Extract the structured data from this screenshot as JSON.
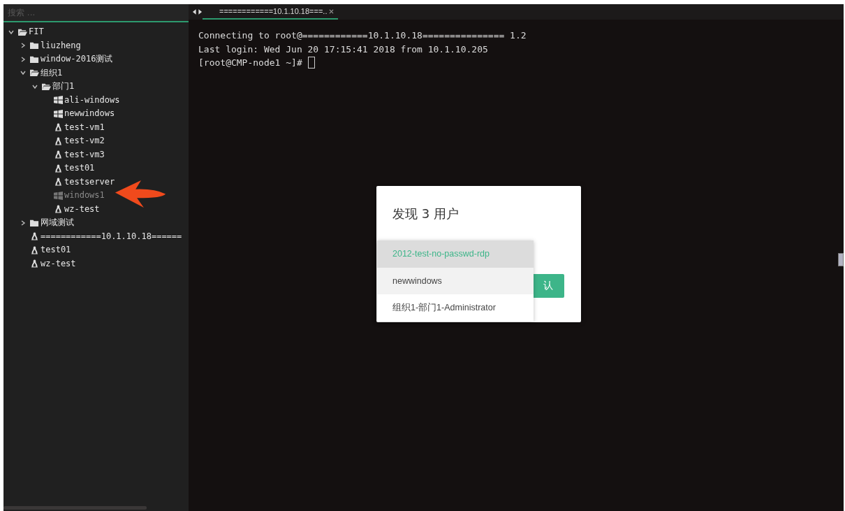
{
  "sidebar": {
    "search": {
      "placeholder": "搜索 ..."
    },
    "tree": [
      {
        "label": "FIT",
        "kind": "folder",
        "expanded": true,
        "disabled": false,
        "children": [
          {
            "label": "liuzheng",
            "kind": "folder",
            "expanded": false,
            "disabled": false
          },
          {
            "label": "window-2016测试",
            "kind": "folder",
            "expanded": false,
            "disabled": false
          },
          {
            "label": "组织1",
            "kind": "folder",
            "expanded": true,
            "disabled": false,
            "children": [
              {
                "label": "部门1",
                "kind": "folder",
                "expanded": true,
                "disabled": false,
                "children": [
                  {
                    "label": "ali-windows",
                    "kind": "windows",
                    "disabled": false
                  },
                  {
                    "label": "newwindows",
                    "kind": "windows",
                    "disabled": false
                  },
                  {
                    "label": "test-vm1",
                    "kind": "linux",
                    "disabled": false
                  },
                  {
                    "label": "test-vm2",
                    "kind": "linux",
                    "disabled": false
                  },
                  {
                    "label": "test-vm3",
                    "kind": "linux",
                    "disabled": false
                  },
                  {
                    "label": "test01",
                    "kind": "linux",
                    "disabled": false
                  },
                  {
                    "label": "testserver",
                    "kind": "linux",
                    "disabled": false
                  },
                  {
                    "label": "windows1",
                    "kind": "windows",
                    "disabled": true
                  },
                  {
                    "label": "wz-test",
                    "kind": "linux",
                    "disabled": false
                  }
                ]
              }
            ]
          },
          {
            "label": "网域测试",
            "kind": "folder",
            "expanded": false,
            "disabled": false
          },
          {
            "label": "============10.1.10.18======",
            "kind": "linux",
            "disabled": false
          },
          {
            "label": "test01",
            "kind": "linux",
            "disabled": false
          },
          {
            "label": "wz-test",
            "kind": "linux",
            "disabled": false
          }
        ]
      }
    ]
  },
  "tabs": [
    {
      "label": "============10.1.10.18===..",
      "selected": true
    }
  ],
  "terminal": {
    "lines": [
      "Connecting to root@============10.1.10.18=============== 1.2",
      "Last login: Wed Jun 20 17:15:41 2018 from 10.1.10.205",
      "[root@CMP-node1 ~]# "
    ]
  },
  "dialog": {
    "title": "发现 3 用户",
    "confirm_button": "认",
    "options": [
      {
        "label": "2012-test-no-passwd-rdp",
        "selected": true,
        "hovered": false
      },
      {
        "label": "newwindows",
        "selected": false,
        "hovered": true
      },
      {
        "label": "组织1-部门1-Administrator",
        "selected": false,
        "hovered": false
      }
    ]
  }
}
